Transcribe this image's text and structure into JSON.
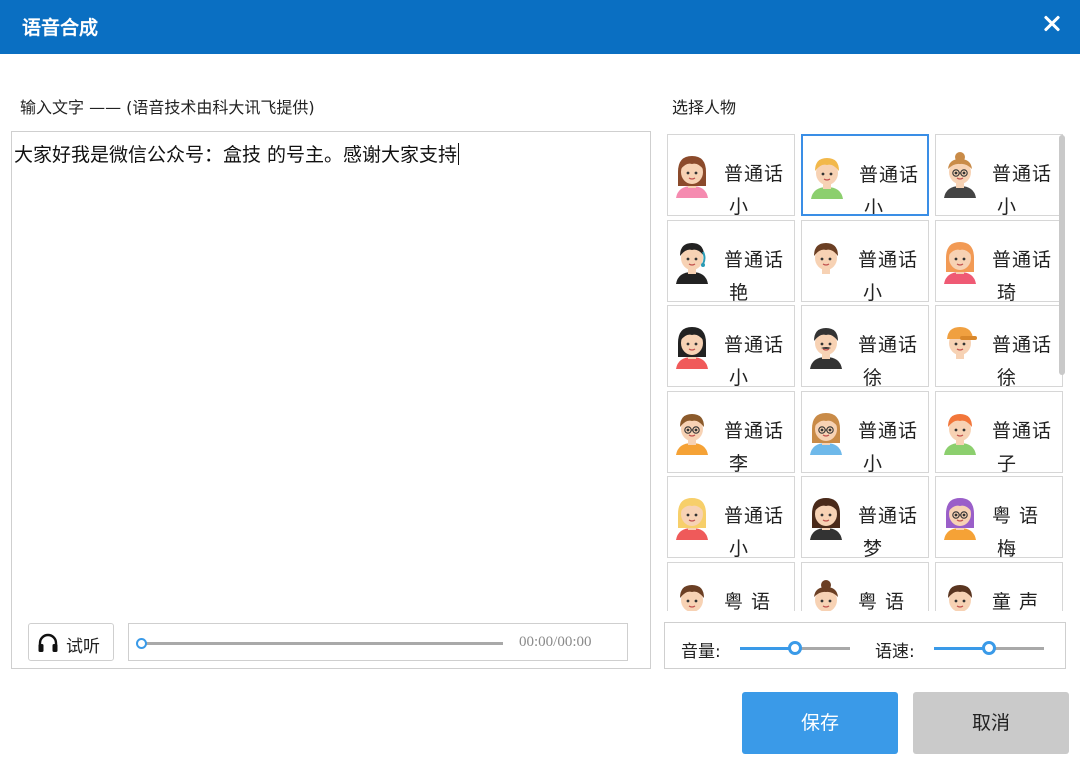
{
  "window": {
    "title": "语音合成"
  },
  "labels": {
    "input_text": "输入文字 —— (语音技术由科大讯飞提供)",
    "select_character": "选择人物"
  },
  "text_input": {
    "value": "大家好我是微信公众号：盒技 的号主。感谢大家支持"
  },
  "player": {
    "listen_label": "试听",
    "time": "00:00/00:00",
    "progress": 0
  },
  "characters": [
    {
      "lang": "普通话",
      "name": "小 琪",
      "avatar": "girl-pink-avatar",
      "selected": false
    },
    {
      "lang": "普通话",
      "name": "小 宇",
      "avatar": "boy-blond-avatar",
      "selected": true
    },
    {
      "lang": "普通话",
      "name": "小 妍",
      "avatar": "woman-glasses-avatar",
      "selected": false
    },
    {
      "lang": "普通话",
      "name": "艳 艳",
      "avatar": "girl-headset-avatar",
      "selected": false
    },
    {
      "lang": "普通话",
      "name": "小 余",
      "avatar": "man-light-avatar",
      "selected": false
    },
    {
      "lang": "普通话",
      "name": "琦 琦",
      "avatar": "girl-orange-hair-avatar",
      "selected": false
    },
    {
      "lang": "普通话",
      "name": "小 梦",
      "avatar": "girl-black-hair-avatar",
      "selected": false
    },
    {
      "lang": "普通话",
      "name": "徐 多",
      "avatar": "man-mustache-avatar",
      "selected": false
    },
    {
      "lang": "普通话",
      "name": "徐 九",
      "avatar": "boy-cap-avatar",
      "selected": false
    },
    {
      "lang": "普通话",
      "name": "李 阳",
      "avatar": "boy-glasses-avatar",
      "selected": false
    },
    {
      "lang": "普通话",
      "name": "小 萍",
      "avatar": "girl-glasses-avatar",
      "selected": false
    },
    {
      "lang": "普通话",
      "name": "子 琪",
      "avatar": "girl-red-hair-avatar",
      "selected": false
    },
    {
      "lang": "普通话",
      "name": "小 芳",
      "avatar": "girl-blonde-avatar",
      "selected": false
    },
    {
      "lang": "普通话",
      "name": "梦 淳",
      "avatar": "woman-long-hair-avatar",
      "selected": false
    },
    {
      "lang": "粤 语",
      "name": "梅 梅",
      "avatar": "woman-purple-hair-avatar",
      "selected": false
    },
    {
      "lang": "粤 语",
      "name": "",
      "avatar": "boy-brown-hair-avatar",
      "selected": false
    },
    {
      "lang": "粤 语",
      "name": "",
      "avatar": "girl-bun-avatar",
      "selected": false
    },
    {
      "lang": "童 声",
      "name": "",
      "avatar": "child-avatar",
      "selected": false
    }
  ],
  "settings": {
    "volume_label": "音量:",
    "volume_value": 0.5,
    "speed_label": "语速:",
    "speed_value": 0.5
  },
  "buttons": {
    "save": "保存",
    "cancel": "取消"
  },
  "colors": {
    "title_bar": "#0a6fc2",
    "accent": "#3a9ae8",
    "selected_border": "#3a8ee6",
    "cancel_bg": "#cacaca"
  }
}
